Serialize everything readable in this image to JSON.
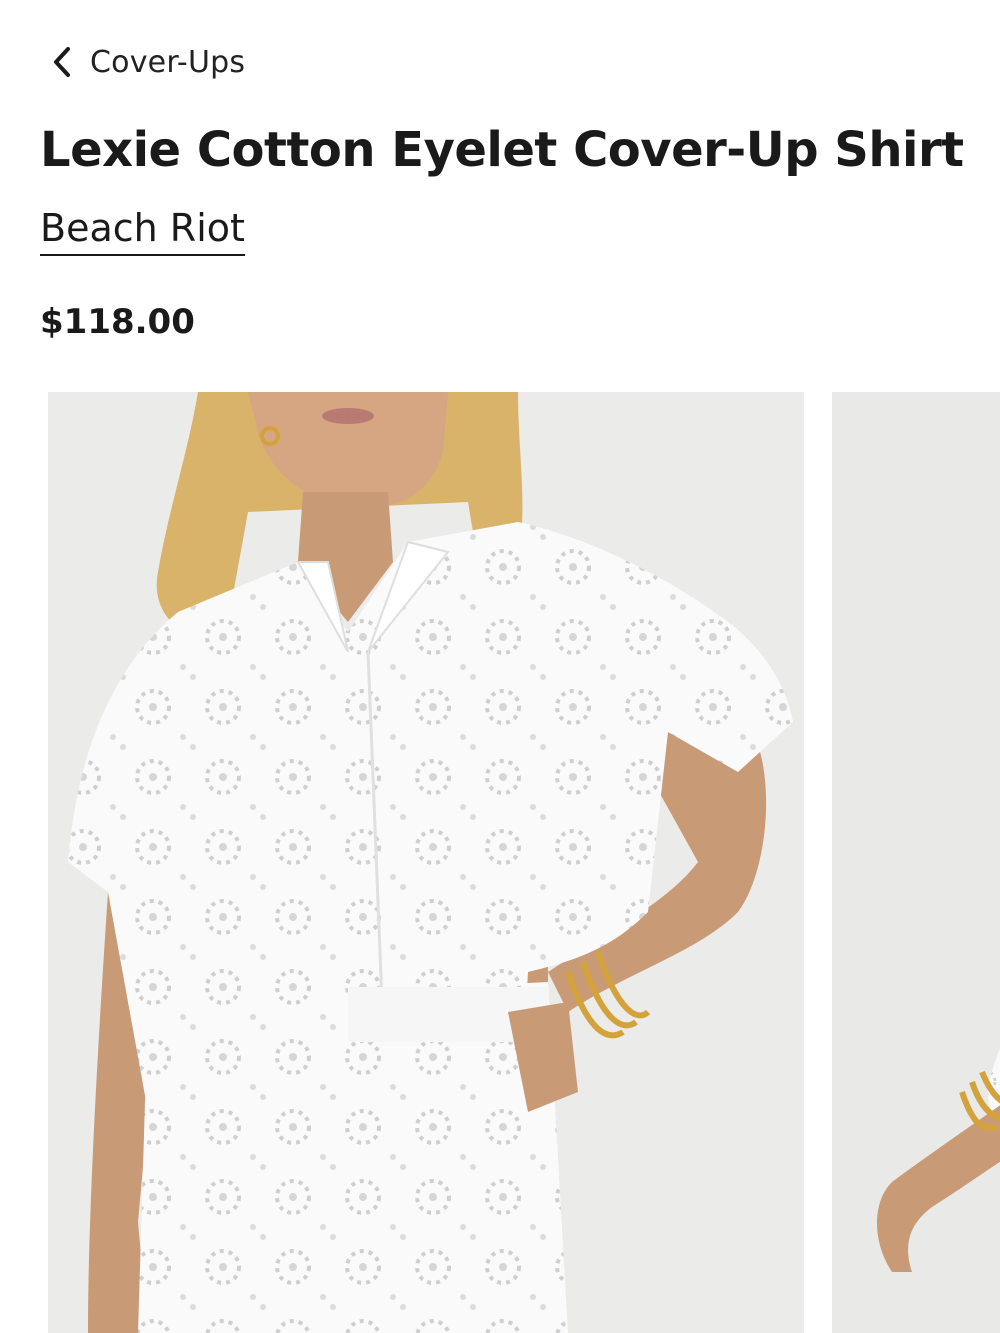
{
  "nav": {
    "back_label": "Cover-Ups"
  },
  "product": {
    "title": "Lexie Cotton Eyelet Cover-Up Shirt",
    "brand": "Beach Riot",
    "price": "$118.00"
  },
  "gallery": {
    "images": [
      {
        "subject": "model-wearing-white-eyelet-shirt-front"
      },
      {
        "subject": "model-wearing-white-eyelet-shirt-side"
      }
    ]
  },
  "colors": {
    "text": "#1a1a1a",
    "image_background": "#ebebea",
    "garment": "#fafafa",
    "skin": "#c99a76",
    "hair": "#d9b36a",
    "gold": "#d4a23a"
  }
}
